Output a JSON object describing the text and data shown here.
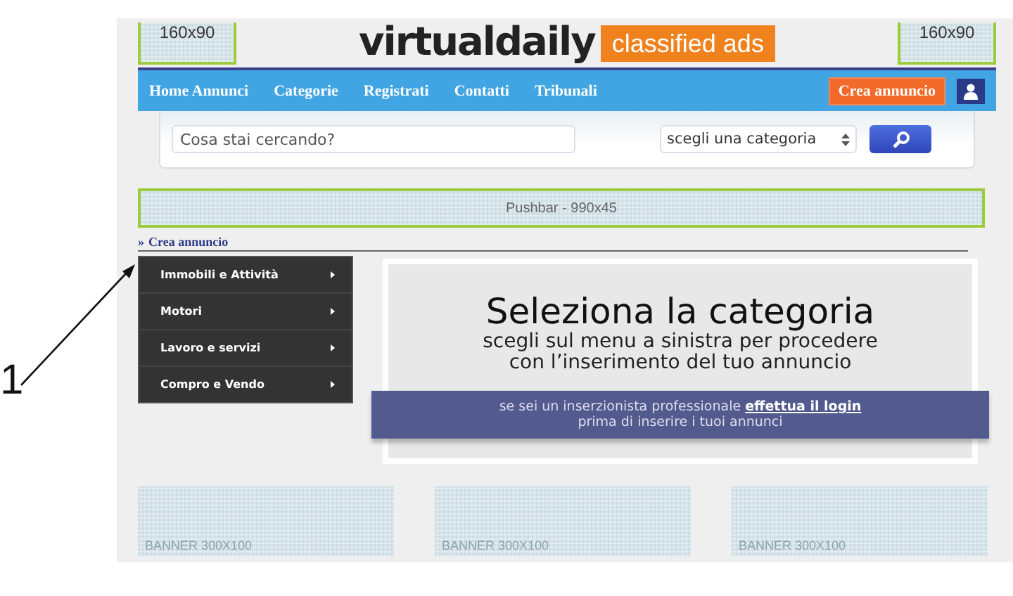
{
  "annotation": {
    "label": "1"
  },
  "header": {
    "left_banner": "160x90",
    "logo": "virtualdaily",
    "logo_tag": "classified ads",
    "right_banner": "160x90"
  },
  "nav": {
    "items": [
      "Home Annunci",
      "Categorie",
      "Registrati",
      "Contatti",
      "Tribunali"
    ],
    "cta": "Crea annuncio"
  },
  "search": {
    "placeholder": "Cosa stai cercando?",
    "category": "scegli una categoria"
  },
  "pushbar": "Pushbar - 990x45",
  "breadcrumb": {
    "marker": "»",
    "label": "Crea annuncio"
  },
  "menu": [
    {
      "label": "Immobili e Attività"
    },
    {
      "label": "Motori"
    },
    {
      "label": "Lavoro e servizi"
    },
    {
      "label": "Compro e Vendo"
    }
  ],
  "card": {
    "title": "Seleziona la categoria",
    "subtitle": [
      "scegli sul menu a sinistra per procedere",
      "con l’inserimento del tuo annuncio"
    ],
    "login_prefix": "se sei un inserzionista professionale",
    "login_link": "effettua il login",
    "login_suffix": "prima di inserire i tuoi annunci"
  },
  "banners": [
    "BANNER 300X100",
    "BANNER 300X100",
    "BANNER 300X100"
  ]
}
